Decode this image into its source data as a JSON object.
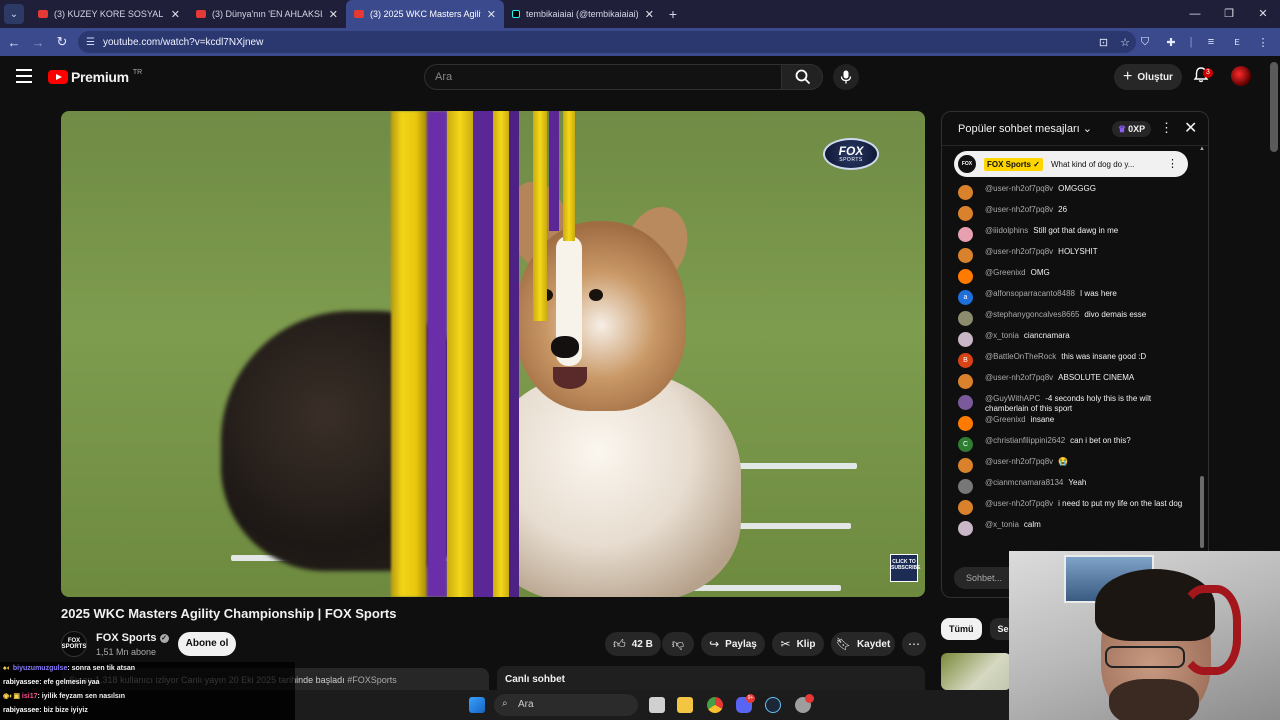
{
  "browser": {
    "tabs": [
      {
        "title": "(3) KUZEY KORE SOSYAL MEDYA",
        "active": false
      },
      {
        "title": "(3) Dünya'nın 'EN AHLAKSIZ' BE",
        "active": false
      },
      {
        "title": "(3) 2025 WKC Masters Agility Ch",
        "active": true
      },
      {
        "title": "tembikaiaiai (@tembikaiaiai) | T",
        "active": false
      }
    ],
    "close_glyph": "✕",
    "new_tab_glyph": "+",
    "url": "youtube.com/watch?v=kcdl7NXjnew",
    "profile_letter": "E"
  },
  "youtube": {
    "logo_text": "Premium",
    "region": "TR",
    "search_placeholder": "Ara",
    "create_label": "Oluştur",
    "notification_count": "3"
  },
  "video": {
    "title": "2025 WKC Masters Agility Championship | FOX Sports",
    "overlay_logo_top": "FOX",
    "overlay_logo_bottom": "SPORTS",
    "subscribe_overlay": "CLICK TO SUBSCRIBE"
  },
  "channel": {
    "avatar_text": "FOX SPORTS",
    "name": "FOX Sports",
    "subscribers": "1,51 Mn abone",
    "subscribe_label": "Abone ol"
  },
  "actions": {
    "likes": "42 B",
    "share": "Paylaş",
    "clip": "Klip",
    "save": "Kaydet"
  },
  "description": {
    "text": "Şu an 1.318 kullanıcı izliyor  Canlı yayın 20 Eki 2025 tarihinde başladı",
    "hashtag": "#FOXSports"
  },
  "live_chat_label": "Canlı sohbet",
  "chat": {
    "header": "Popüler sohbet mesajları",
    "xp": "0XP",
    "pinned": {
      "avatar": "FOX",
      "author": "FOX Sports ✓",
      "text": "What kind of dog do y..."
    },
    "messages": [
      {
        "author": "@user-nh2of7pq8v",
        "text": "OMGGGG",
        "avatar_color": "#d9822b",
        "initial": ""
      },
      {
        "author": "@user-nh2of7pq8v",
        "text": "26",
        "avatar_color": "#d9822b",
        "initial": ""
      },
      {
        "author": "@iiidolphins",
        "text": "Still got that dawg in me",
        "avatar_color": "#e6a0b0",
        "initial": ""
      },
      {
        "author": "@user-nh2of7pq8v",
        "text": "HOLYSHIT",
        "avatar_color": "#d9822b",
        "initial": ""
      },
      {
        "author": "@Greenixd",
        "text": "OMG",
        "avatar_color": "#ff7a00",
        "initial": ""
      },
      {
        "author": "@alfonsoparracanto8488",
        "text": "I was here",
        "avatar_color": "#1e6fd9",
        "initial": "a"
      },
      {
        "author": "@stephanygoncalves8665",
        "text": "divo demais esse",
        "avatar_color": "#8c8c6c",
        "initial": ""
      },
      {
        "author": "@x_tonia",
        "text": "ciancnamara",
        "avatar_color": "#c9b6c6",
        "initial": ""
      },
      {
        "author": "@BattleOnTheRock",
        "text": "this was insane good :D",
        "avatar_color": "#d84315",
        "initial": "B"
      },
      {
        "author": "@user-nh2of7pq8v",
        "text": "ABSOLUTE CINEMA",
        "avatar_color": "#d9822b",
        "initial": ""
      },
      {
        "author": "@GuyWithAPC",
        "text": "-4 seconds holy this is the wilt chamberlain of this sport",
        "avatar_color": "#7a5a9a",
        "initial": ""
      },
      {
        "author": "@Greenixd",
        "text": "insane",
        "avatar_color": "#ff7a00",
        "initial": ""
      },
      {
        "author": "@christianfilippini2642",
        "text": "can i bet on this?",
        "avatar_color": "#2e7d32",
        "initial": "C"
      },
      {
        "author": "@user-nh2of7pq8v",
        "text": "😭",
        "avatar_color": "#d9822b",
        "initial": ""
      },
      {
        "author": "@cianmcnamara8134",
        "text": "Yeah",
        "avatar_color": "#777777",
        "initial": ""
      },
      {
        "author": "@user-nh2of7pq8v",
        "text": "i need to put my life on the last dog",
        "avatar_color": "#d9822b",
        "initial": ""
      },
      {
        "author": "@x_tonia",
        "text": "calm",
        "avatar_color": "#c9b6c6",
        "initial": ""
      }
    ],
    "input_placeholder": "Sohbet..."
  },
  "filter_chips": [
    "Tümü",
    "Seri"
  ],
  "stream_overlay": [
    {
      "user": "biyuzumuzgulse",
      "text": ": sonra sen tik atsan"
    },
    {
      "user": "rabiyassee",
      "text": ": efe gelmesin yaa"
    },
    {
      "user": "isi17",
      "text": ": iyilik feyzam sen nasılsın"
    },
    {
      "user": "rabiyassee",
      "text": ": biz bize iyiyiz"
    }
  ],
  "taskbar": {
    "search_label": "Ara",
    "chat_badge": "9+"
  }
}
